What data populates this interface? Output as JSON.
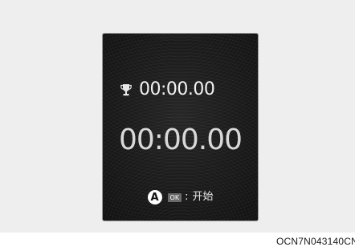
{
  "stopwatch": {
    "best_time": "00:00.00",
    "current_time": "00:00.00",
    "best_icon": "trophy-icon"
  },
  "hint": {
    "marker": "A",
    "key_label": "OK",
    "separator": ":",
    "action_text": "开始"
  },
  "figure_code": "OCN7N043140CN",
  "colors": {
    "background": "#eeeeee",
    "screen": "#1c1c1c",
    "text": "#f2f2f2",
    "key": "#6a6a6a"
  }
}
